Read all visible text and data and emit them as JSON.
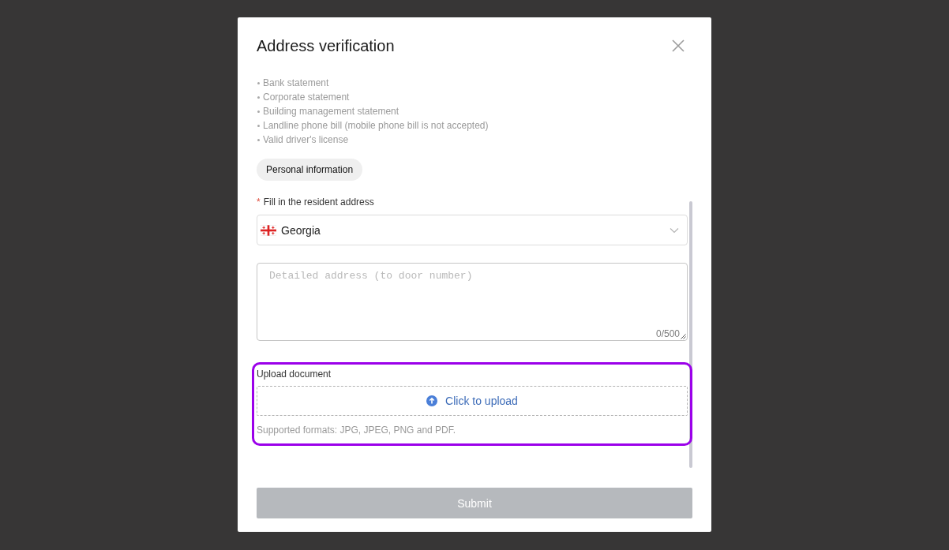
{
  "dialog": {
    "title": "Address verification"
  },
  "documents": [
    "Bank statement",
    "Corporate statement",
    "Building management statement",
    "Landline phone bill (mobile phone bill is not accepted)",
    "Valid driver's license"
  ],
  "section_tag": {
    "label": "Personal information"
  },
  "address": {
    "required_mark": "*",
    "label": "Fill in the resident address",
    "country": {
      "value": "Georgia"
    },
    "detail": {
      "placeholder": "Detailed address (to door number)",
      "counter": "0/500"
    }
  },
  "upload": {
    "label": "Upload document",
    "action": "Click to upload",
    "hint": "Supported formats: JPG, JPEG, PNG and PDF."
  },
  "submit": {
    "label": "Submit",
    "disabled": true
  }
}
